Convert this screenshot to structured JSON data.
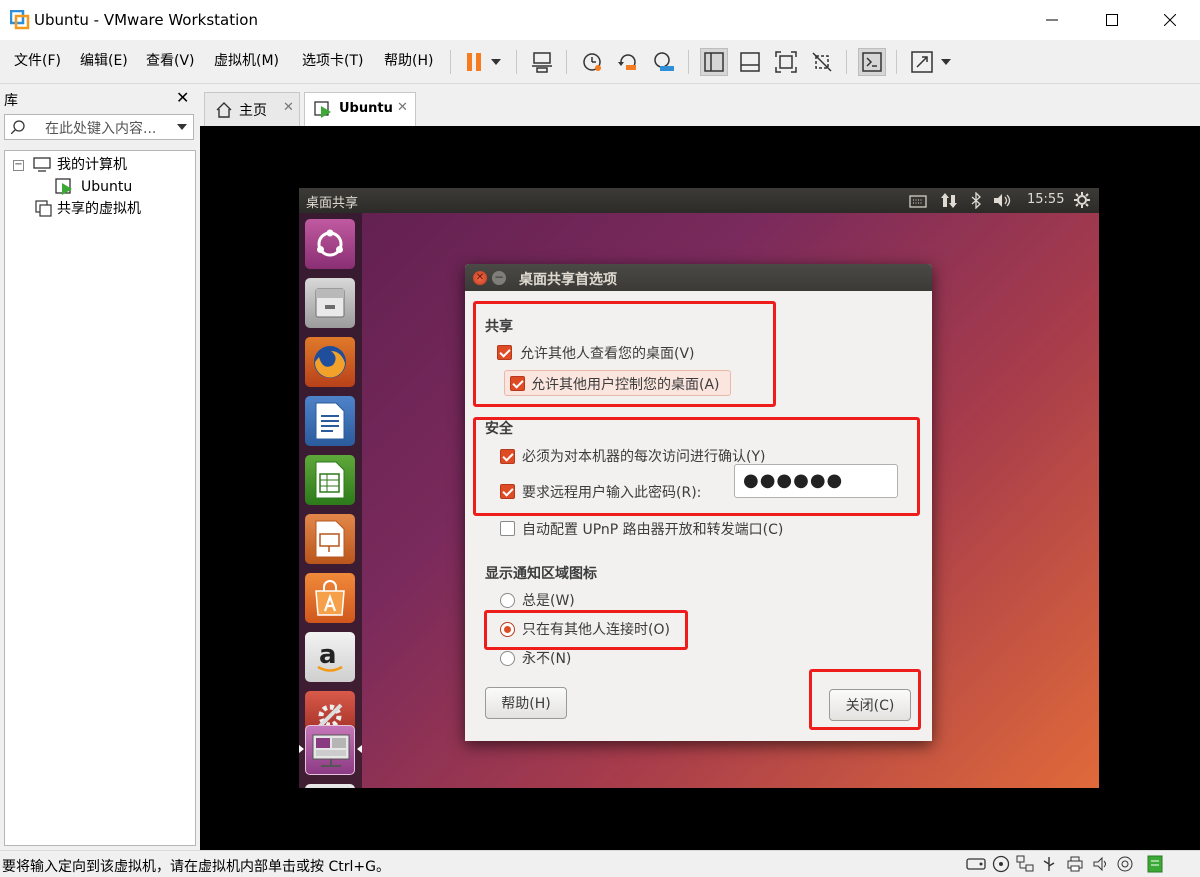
{
  "window": {
    "title": "Ubuntu - VMware Workstation"
  },
  "menu": [
    "文件(F)",
    "编辑(E)",
    "查看(V)",
    "虚拟机(M)",
    "选项卡(T)",
    "帮助(H)"
  ],
  "library": {
    "title": "库",
    "search_placeholder": "在此处键入内容...",
    "tree": {
      "root": "我的计算机",
      "child": "Ubuntu",
      "shared": "共享的虚拟机"
    }
  },
  "tabs": [
    {
      "label": "主页"
    },
    {
      "label": "Ubuntu"
    }
  ],
  "ubuntu": {
    "topbar_title": "桌面共享",
    "time": "15:55",
    "dialog": {
      "title": "桌面共享首选项",
      "sharing_heading": "共享",
      "allow_view": "允许其他人查看您的桌面(V)",
      "allow_control": "允许其他用户控制您的桌面(A)",
      "security_heading": "安全",
      "confirm_each": "必须为对本机器的每次访问进行确认(Y)",
      "require_password": "要求远程用户输入此密码(R):",
      "password_value": "●●●●●●",
      "upnp": "自动配置 UPnP 路由器开放和转发端口(C)",
      "notify_heading": "显示通知区域图标",
      "opt_always": "总是(W)",
      "opt_connected": "只在有其他人连接时(O)",
      "opt_never": "永不(N)",
      "help_button": "帮助(H)",
      "close_button": "关闭(C)"
    }
  },
  "status": {
    "message": "要将输入定向到该虚拟机，请在虚拟机内部单击或按 Ctrl+G。"
  },
  "colors": {
    "ubuntu_orange": "#df4b25",
    "highlight_red": "#ef1c1c"
  }
}
